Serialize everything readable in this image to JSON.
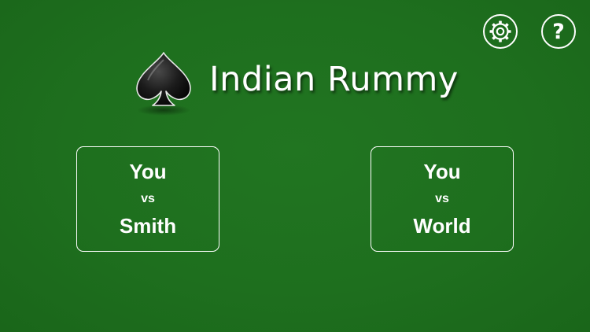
{
  "app": {
    "title": "Indian Rummy",
    "logo_icon": "spade-icon",
    "background_color": "#1d6e1d"
  },
  "toolbar": {
    "settings_icon": "gear-icon",
    "help_label": "?"
  },
  "modes": [
    {
      "line1": "You",
      "line2": "vs",
      "line3": "Smith"
    },
    {
      "line1": "You",
      "line2": "vs",
      "line3": "World"
    }
  ]
}
